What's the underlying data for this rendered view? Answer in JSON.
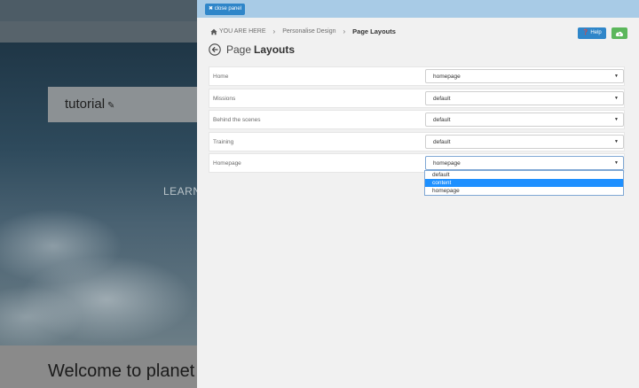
{
  "background_site": {
    "tutorial_label": "tutorial",
    "learn_text": "LEARN",
    "welcome_text": "Welcome to planet"
  },
  "panel": {
    "close_label": "close panel",
    "breadcrumb": {
      "you_are_here": "YOU ARE HERE",
      "parent": "Personalise Design",
      "current": "Page Layouts"
    },
    "help_label": "Help",
    "title": {
      "light": "Page",
      "bold": "Layouts"
    },
    "rows": [
      {
        "label": "Home",
        "value": "homepage"
      },
      {
        "label": "Missions",
        "value": "default"
      },
      {
        "label": "Behind the scenes",
        "value": "default"
      },
      {
        "label": "Training",
        "value": "default"
      },
      {
        "label": "Homepage",
        "value": "homepage"
      }
    ],
    "dropdown": {
      "options": [
        "default",
        "content",
        "homepage"
      ],
      "highlighted_index": 1
    },
    "colors": {
      "header": "#a8cbe6",
      "primary_button": "#2f86c9",
      "success_button": "#5bb75b",
      "highlight": "#1e90ff"
    }
  }
}
